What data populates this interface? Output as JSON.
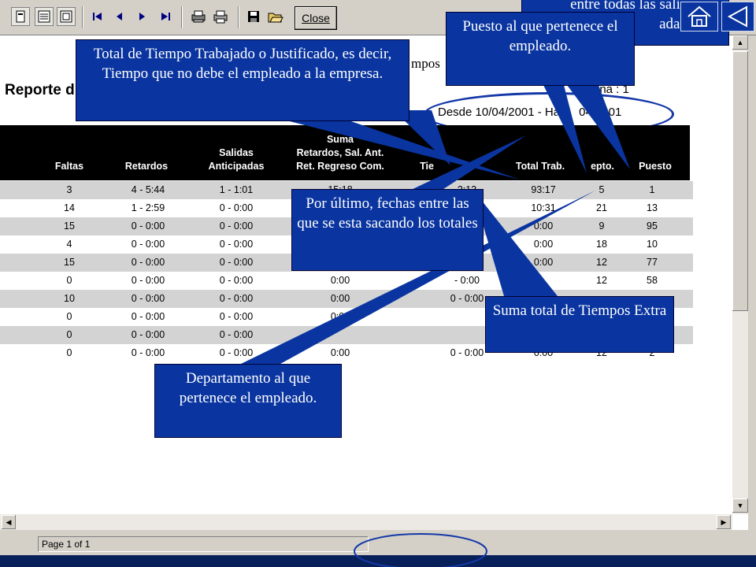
{
  "toolbar": {
    "close_label": "Close",
    "icons": [
      "single-page-icon",
      "multi-page-icon",
      "zoom-icon",
      "first-page-icon",
      "prev-page-icon",
      "next-page-icon",
      "last-page-icon",
      "print-setup-icon",
      "print-icon",
      "save-icon",
      "open-icon"
    ]
  },
  "report": {
    "title": "Reporte d",
    "tiempos_fragment": "mpos",
    "pagina_fragment": "ina : 1",
    "date_range": "Desde 10/04/2001 - Ha",
    "date_range_end": "04/2001"
  },
  "table": {
    "headers": {
      "faltas": "Faltas",
      "retardos": "Retardos",
      "salidas_1": "Salidas",
      "salidas_2": "Anticipadas",
      "suma_1": "Suma",
      "suma_2": "Retardos, Sal. Ant.",
      "suma_3": "Ret. Regreso Com.",
      "tiempo_extra": "Tie",
      "total_trab": "Total Trab.",
      "depto": "epto.",
      "puesto": "Puesto"
    },
    "rows": [
      [
        "3",
        "4 - 5:44",
        "1 - 1:01",
        "15:18",
        "2:13",
        "93:17",
        "5",
        "1"
      ],
      [
        "14",
        "1 - 2:59",
        "0 - 0:00",
        "",
        "",
        "10:31",
        "21",
        "13"
      ],
      [
        "15",
        "0 - 0:00",
        "0 - 0:00",
        "",
        "",
        "0:00",
        "9",
        "95"
      ],
      [
        "4",
        "0 - 0:00",
        "0 - 0:00",
        "",
        "",
        "0:00",
        "18",
        "10"
      ],
      [
        "15",
        "0 - 0:00",
        "0 - 0:00",
        "",
        "",
        "0:00",
        "12",
        "77"
      ],
      [
        "0",
        "0 - 0:00",
        "0 - 0:00",
        "0:00",
        "- 0:00",
        "",
        "12",
        "58"
      ],
      [
        "10",
        "0 - 0:00",
        "0 - 0:00",
        "0:00",
        "0 - 0:00",
        "",
        "",
        ""
      ],
      [
        "0",
        "0 - 0:00",
        "0 - 0:00",
        "0:00",
        "",
        "",
        "",
        ""
      ],
      [
        "0",
        "0 - 0:00",
        "0 - 0:00",
        "",
        "",
        "",
        "",
        ""
      ],
      [
        "0",
        "0 - 0:00",
        "0 - 0:00",
        "0:00",
        "0 - 0:00",
        "0:00",
        "12",
        "2"
      ]
    ]
  },
  "status": {
    "page": "Page 1 of 1"
  },
  "callouts": {
    "total_tiempo": "Total de Tiempo Trabajado o Justificado, es decir, Tiempo que no debe el empleado a la empresa.",
    "puesto": "Puesto al que pertenece el empleado.",
    "fechas": "Por último, fechas entre las que se esta sacando los totales",
    "tiempos_extra": "Suma total de Tiempos Extra",
    "departamento": "Departamento al que pertenece el empleado.",
    "top_partial_1": "entre todas las sali",
    "top_partial_2": "adas"
  },
  "nav": {
    "home_icon": "home-icon",
    "back_icon": "back-triangle-icon"
  },
  "colors": {
    "callout_bg": "#0a35a0",
    "header_bg": "#000000",
    "row_shade": "#d3d3d3",
    "ellipse": "#1438a8"
  }
}
